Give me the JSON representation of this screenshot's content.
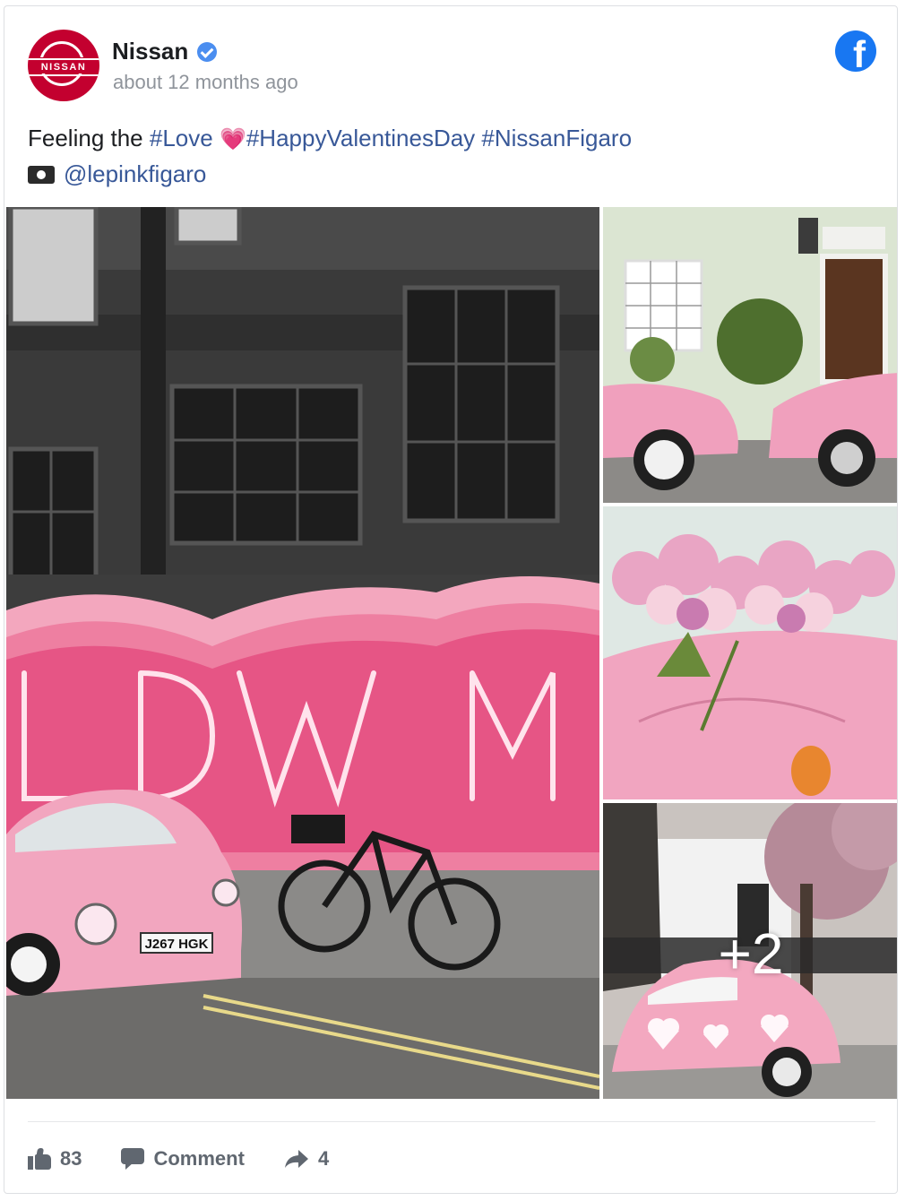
{
  "post": {
    "page_name": "Nissan",
    "avatar_brand": "NISSAN",
    "timestamp": "about 12 months ago",
    "caption": {
      "text_before": "Feeling the ",
      "tag_love": "#Love",
      "heart_emoji": "💗",
      "tag_valentines": "#HappyValentinesDay",
      "tag_figaro": "#NissanFigaro",
      "handle": "@lepinkfigaro"
    },
    "more_photos": "+2"
  },
  "actions": {
    "likes": "83",
    "comment_label": "Comment",
    "shares": "4"
  },
  "colors": {
    "facebook_blue": "#1877f2",
    "hashtag": "#385898",
    "nissan_red": "#c3002f",
    "verified": "#4b8ef0"
  },
  "icons": [
    "verified-badge-icon",
    "facebook-icon",
    "camera-icon",
    "like-icon",
    "comment-icon",
    "share-icon"
  ]
}
